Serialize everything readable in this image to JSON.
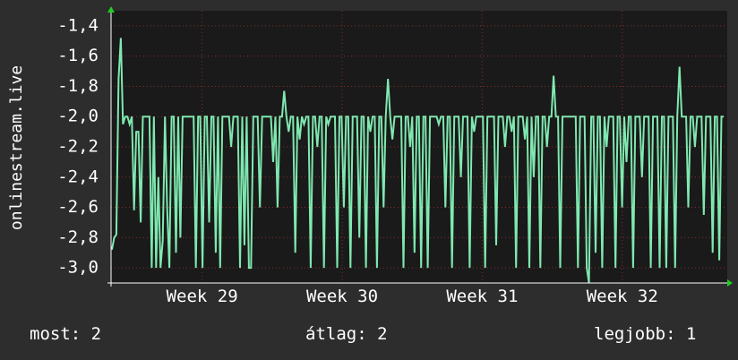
{
  "chart_data": {
    "type": "line",
    "ylabel": "onlinestream.live",
    "xlabel": "",
    "title": "",
    "ylim": [
      -3.1,
      -1.3
    ],
    "y_ticks": [
      -1.4,
      -1.6,
      -1.8,
      -2.0,
      -2.2,
      -2.4,
      -2.6,
      -2.8,
      -3.0
    ],
    "y_tick_labels": [
      "-1,4",
      "-1,6",
      "-1,8",
      "-2,0",
      "-2,2",
      "-2,4",
      "-2,6",
      "-2,8",
      "-3,0"
    ],
    "x_ticks": [
      {
        "label": "Week 29",
        "week": 29
      },
      {
        "label": "Week 30",
        "week": 30
      },
      {
        "label": "Week 31",
        "week": 31
      },
      {
        "label": "Week 32",
        "week": 32
      }
    ],
    "xlim_weeks": [
      28.35,
      32.75
    ],
    "series": [
      {
        "color": "#7fe8b0",
        "values": [
          -2.88,
          -2.8,
          -2.78,
          -1.75,
          -1.48,
          -2.05,
          -2.0,
          -2.0,
          -2.05,
          -2.0,
          -2.62,
          -2.1,
          -2.1,
          -2.7,
          -2.0,
          -2.0,
          -2.0,
          -2.0,
          -3.0,
          -2.0,
          -3.0,
          -2.4,
          -3.0,
          -2.82,
          -2.0,
          -2.6,
          -3.0,
          -2.0,
          -2.0,
          -2.9,
          -2.0,
          -2.8,
          -2.0,
          -2.0,
          -2.0,
          -2.0,
          -2.0,
          -2.0,
          -3.0,
          -2.0,
          -2.0,
          -3.0,
          -2.0,
          -2.0,
          -2.7,
          -2.0,
          -2.0,
          -2.9,
          -2.0,
          -3.0,
          -2.0,
          -2.0,
          -2.0,
          -2.0,
          -2.2,
          -2.0,
          -2.0,
          -2.0,
          -3.0,
          -2.0,
          -2.85,
          -2.0,
          -3.0,
          -3.0,
          -2.0,
          -2.0,
          -2.0,
          -2.6,
          -2.0,
          -2.0,
          -2.0,
          -2.0,
          -2.0,
          -2.3,
          -2.0,
          -2.6,
          -2.0,
          -2.0,
          -1.83,
          -2.0,
          -2.1,
          -2.0,
          -2.0,
          -2.9,
          -2.0,
          -2.15,
          -2.0,
          -2.05,
          -2.0,
          -2.0,
          -3.0,
          -2.0,
          -2.0,
          -2.2,
          -2.0,
          -2.0,
          -3.0,
          -2.0,
          -2.05,
          -2.0,
          -2.0,
          -2.0,
          -3.0,
          -2.0,
          -2.0,
          -2.6,
          -2.0,
          -2.0,
          -3.0,
          -2.0,
          -2.0,
          -2.0,
          -2.8,
          -2.0,
          -2.0,
          -3.0,
          -2.0,
          -2.1,
          -2.0,
          -2.0,
          -3.0,
          -2.0,
          -2.0,
          -2.6,
          -2.0,
          -1.75,
          -2.0,
          -2.15,
          -2.0,
          -2.0,
          -2.0,
          -2.0,
          -3.0,
          -2.0,
          -2.0,
          -2.2,
          -2.0,
          -2.9,
          -2.0,
          -2.0,
          -3.0,
          -2.0,
          -2.0,
          -3.0,
          -2.0,
          -2.0,
          -2.0,
          -2.0,
          -2.05,
          -2.0,
          -2.0,
          -2.6,
          -2.0,
          -2.0,
          -3.0,
          -2.0,
          -2.0,
          -2.0,
          -2.4,
          -2.0,
          -2.0,
          -2.0,
          -3.0,
          -2.0,
          -2.1,
          -2.0,
          -2.0,
          -2.0,
          -2.0,
          -3.0,
          -2.0,
          -2.0,
          -2.0,
          -2.0,
          -2.85,
          -2.0,
          -2.0,
          -2.0,
          -2.2,
          -2.0,
          -2.0,
          -2.1,
          -2.0,
          -3.0,
          -2.0,
          -2.0,
          -2.0,
          -2.15,
          -2.0,
          -3.0,
          -2.0,
          -2.4,
          -2.0,
          -2.0,
          -3.0,
          -2.0,
          -2.0,
          -2.2,
          -2.0,
          -2.0,
          -1.73,
          -2.0,
          -2.0,
          -3.0,
          -2.0,
          -2.0,
          -2.0,
          -2.0,
          -2.0,
          -2.0,
          -2.0,
          -3.0,
          -2.0,
          -2.0,
          -2.0,
          -3.0,
          -3.1,
          -2.0,
          -2.0,
          -2.9,
          -2.0,
          -2.0,
          -3.0,
          -2.0,
          -2.2,
          -2.0,
          -2.0,
          -2.0,
          -3.0,
          -2.0,
          -2.0,
          -2.6,
          -2.0,
          -2.3,
          -2.0,
          -2.0,
          -3.0,
          -2.0,
          -2.0,
          -2.0,
          -2.4,
          -2.0,
          -2.0,
          -2.0,
          -3.0,
          -2.0,
          -2.0,
          -2.0,
          -3.0,
          -2.0,
          -2.0,
          -3.0,
          -2.0,
          -2.0,
          -2.0,
          -3.0,
          -2.0,
          -1.67,
          -2.0,
          -2.0,
          -2.0,
          -2.6,
          -2.0,
          -2.0,
          -2.2,
          -2.0,
          -2.0,
          -2.0,
          -2.65,
          -2.0,
          -2.0,
          -2.0,
          -2.9,
          -2.0,
          -2.0,
          -2.95,
          -2.0,
          -2.0
        ]
      }
    ],
    "grid": true,
    "colors": {
      "background": "#2d2d2d",
      "plot_area": "#1a1a1a",
      "grid_line": "#8a2a2a",
      "axis": "#ffffff",
      "axis_arrow": "#22cc22",
      "line": "#7fe8b0"
    }
  },
  "footer": {
    "now": "most: 2",
    "avg": "átlag: 2",
    "best": "legjobb: 1"
  }
}
